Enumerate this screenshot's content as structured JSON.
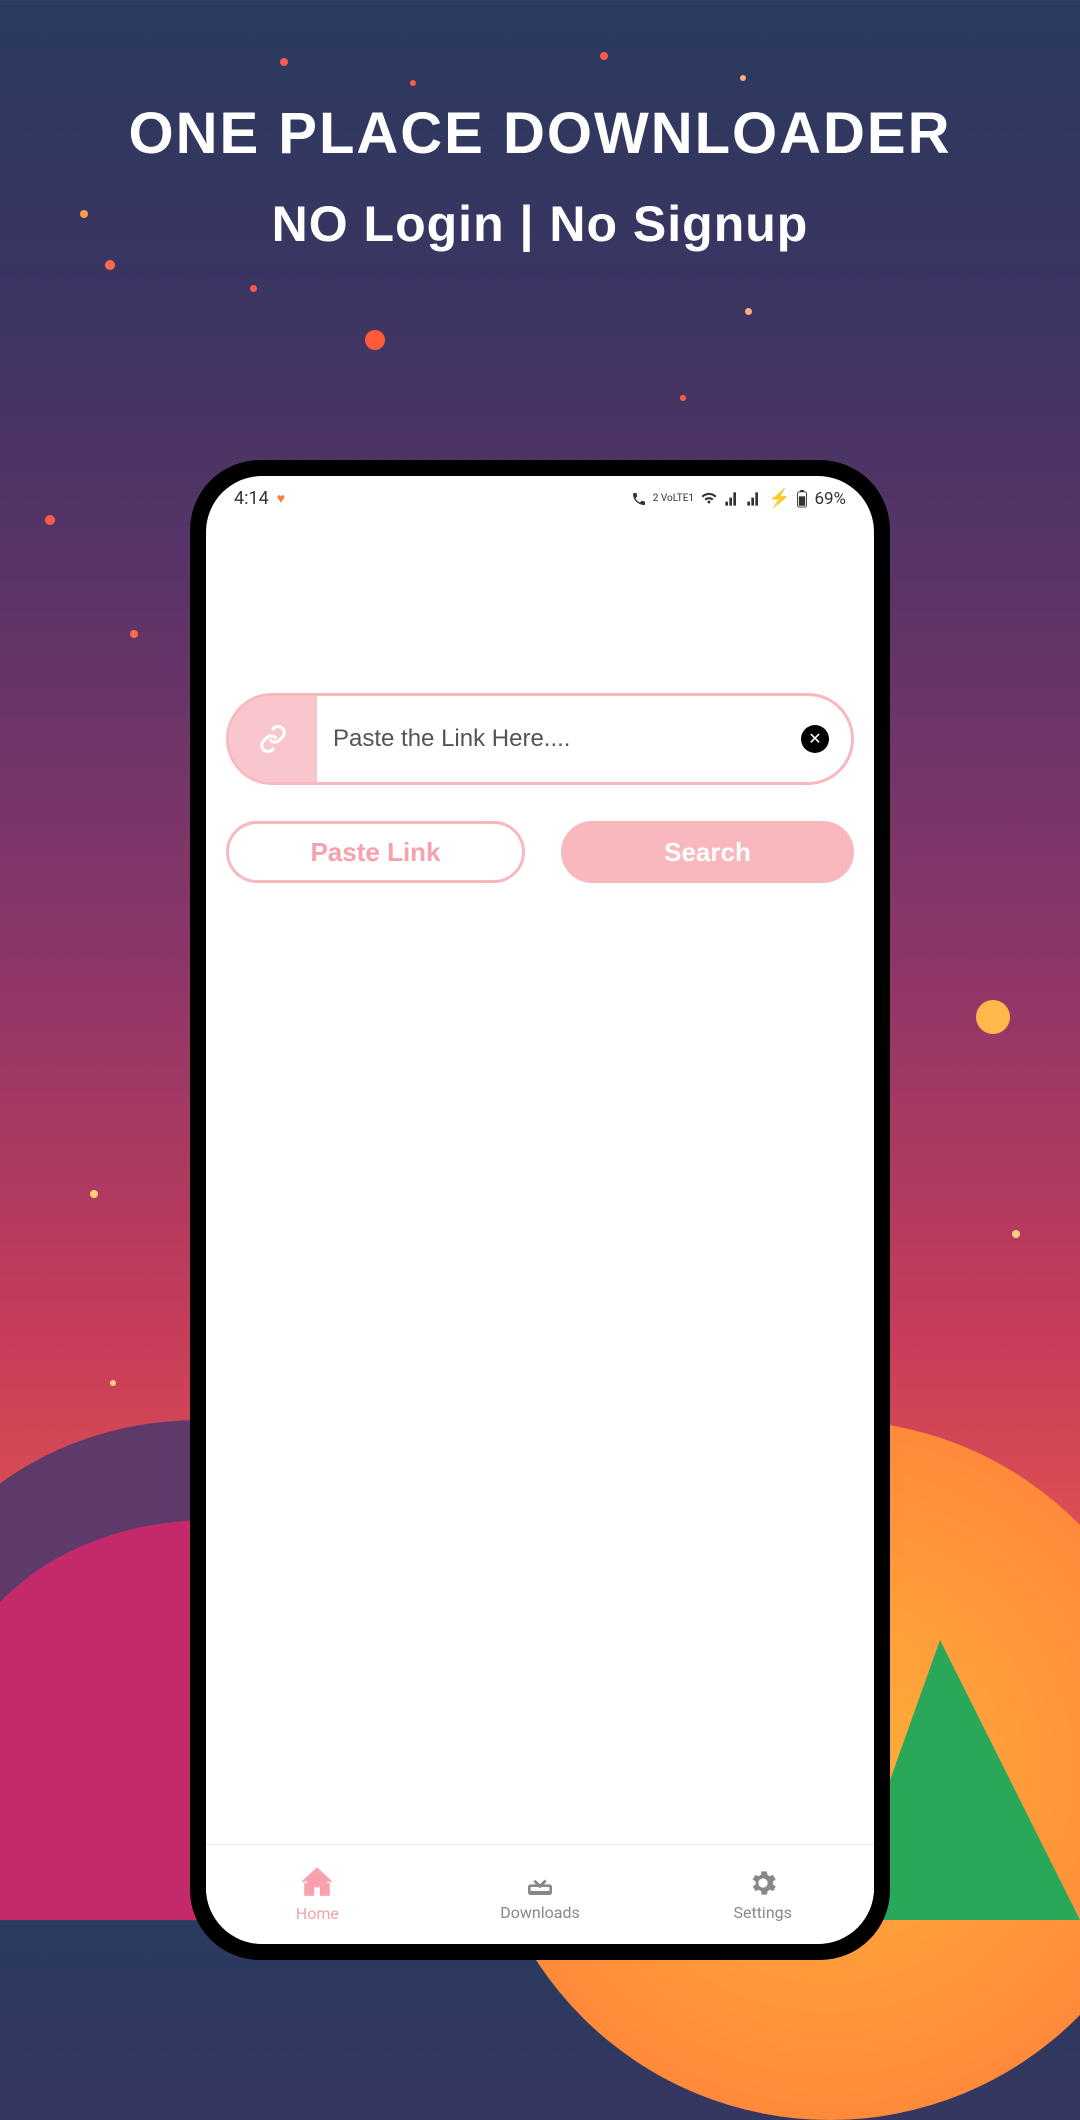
{
  "promo": {
    "title": "ONE PLACE DOWNLOADER",
    "subtitle": "NO Login | No Signup"
  },
  "statusBar": {
    "time": "4:14",
    "lteLabel": "2 VoLTE1",
    "battery": "69%"
  },
  "input": {
    "placeholder": "Paste the Link Here...."
  },
  "buttons": {
    "paste": "Paste Link",
    "search": "Search"
  },
  "nav": {
    "home": "Home",
    "downloads": "Downloads",
    "settings": "Settings"
  }
}
